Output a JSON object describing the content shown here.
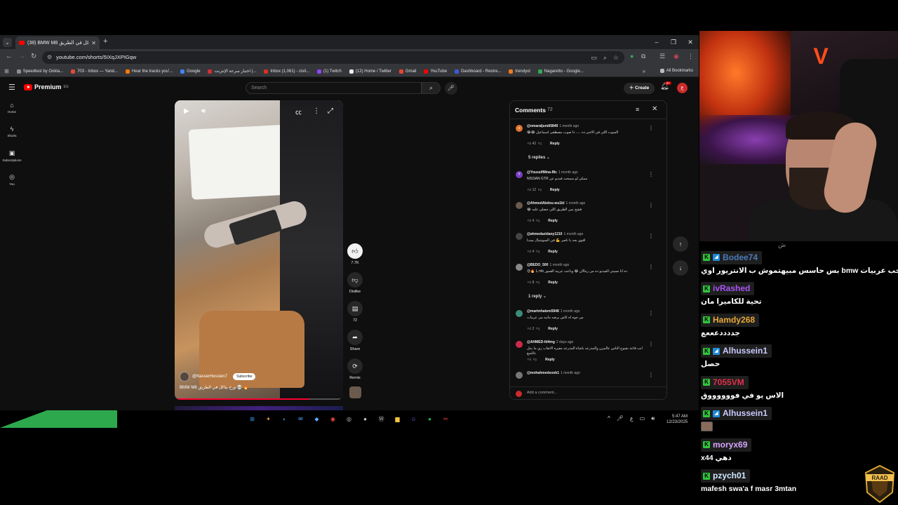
{
  "browser": {
    "tab_title": "(38) BMW M8 بياكل في الطريق",
    "new_tab": "+",
    "url": "youtube.com/shorts/5IXqJXPIGqw",
    "bookmarks": [
      {
        "label": "Speedtest by Ookla...",
        "color": "#8e8e8e"
      },
      {
        "label": "703 - Inbox — Yand...",
        "color": "#e04a3a"
      },
      {
        "label": "Hear the tracks you'...",
        "color": "#ff7a00"
      },
      {
        "label": "Google",
        "color": "#4285f4"
      },
      {
        "label": "اختبار سرعة الإنترنت |...",
        "color": "#d32f2f"
      },
      {
        "label": "Inbox (1,061) - civil...",
        "color": "#d93025"
      },
      {
        "label": "(1) Twitch",
        "color": "#9146ff"
      },
      {
        "label": "(12) Home / Twitter",
        "color": "#eeeeee"
      },
      {
        "label": "Gmail",
        "color": "#ea4335"
      },
      {
        "label": "YouTube",
        "color": "#ff0000"
      },
      {
        "label": "Dashboard - Restre...",
        "color": "#3b5bdb"
      },
      {
        "label": "trendyol",
        "color": "#f27a1a"
      },
      {
        "label": "Nagaretto - Google...",
        "color": "#34a853"
      }
    ],
    "all_bookmarks": "All Bookmarks"
  },
  "youtube": {
    "logo_text": "Premium",
    "logo_region": "EG",
    "search_placeholder": "Search",
    "create_label": "Create",
    "notif_count": "9+",
    "avatar_letter": "ع",
    "guide": [
      {
        "icon": "home-icon",
        "label": "Home"
      },
      {
        "icon": "shorts-icon",
        "label": "Shorts"
      },
      {
        "icon": "subscriptions-icon",
        "label": "Subscriptions"
      },
      {
        "icon": "you-icon",
        "label": "You"
      }
    ]
  },
  "short": {
    "channel": "@NasserHessien7",
    "subscribe": "Subscribe",
    "title": "BMW M8 ورخ بياكل في الطريق 💀 🔥",
    "progress": 0.8,
    "likes": "7.7K",
    "dislike_label": "Dislike",
    "comments_count": "72",
    "share_label": "Share",
    "remix_label": "Remix"
  },
  "comments_panel": {
    "title": "Comments",
    "count": "72",
    "add_comment": "Add a comment...",
    "items": [
      {
        "author": "@omaraljundi5849",
        "time": "1 month ago",
        "text": "السوت اللي في الاخير ده ..... دا صوت مصطفى اسماعيل 😂😂",
        "likes": "42",
        "reply": "Reply",
        "avatar": "o",
        "color": "#e0752c",
        "replies": "5 replies"
      },
      {
        "author": "@YoussifMina-f8c",
        "time": "1 month ago",
        "text": "ممكن لو سمحت فيديو عن NISSAN GTR",
        "likes": "12",
        "reply": "Reply",
        "avatar": "Y",
        "color": "#7a3fc2",
        "replies": ""
      },
      {
        "author": "@AhmedAbdou-wu1bl",
        "time": "1 month ago",
        "text": "فشخ يس الطريق اللي حصلي عليه 😂",
        "likes": "4",
        "reply": "Reply",
        "avatar": "",
        "color": "#6d5a4a",
        "replies": ""
      },
      {
        "author": "@ahmedazidany1210",
        "time": "1 month ago",
        "text": "اقوي بحد يا ناصر 💪 في السوشيال ميديا",
        "likes": "4",
        "reply": "Reply",
        "avatar": "",
        "color": "#444444",
        "replies": ""
      },
      {
        "author": "@BEDO_500",
        "time": "1 month ago",
        "text": "ده انا نسيتي الفيديو ده من زمااان 😂 وباعت عربية القمور mb يا 🔥😍",
        "likes": "8",
        "reply": "Reply",
        "avatar": "",
        "color": "#888888",
        "replies": "1 reply"
      },
      {
        "author": "@marimhatem5948",
        "time": "1 month ago",
        "text": "من جوه اه كاش برضه مانيه من عربيات",
        "likes": "2",
        "reply": "Reply",
        "avatar": "",
        "color": "#3a8d7a",
        "replies": ""
      },
      {
        "author": "@AHMED-fd4mg",
        "time": "2 days ago",
        "text": "انت قاعد تشوح الناس عالمزن والمدرعه باشاة المدرعه مقيره الانقاب زي ما ينتل عالميع",
        "likes": "",
        "reply": "Reply",
        "avatar": "",
        "color": "#cc2b4b",
        "replies": ""
      },
      {
        "author": "@mohahmedsook1",
        "time": "1 month ago",
        "text": "",
        "likes": "",
        "reply": "",
        "avatar": "",
        "color": "#777777",
        "replies": ""
      }
    ]
  },
  "taskbar": {
    "time": "5:47 AM",
    "date": "12/23/2025",
    "lang": "ع"
  },
  "chat": {
    "top_text": "ش",
    "messages": [
      {
        "user": "Bodee74",
        "color": "#4a7ab8",
        "prime": true,
        "text": "بس حاسس مبيهتموش ب الانتريور اوي bmw بحب عربيات",
        "emote": false
      },
      {
        "user": "ivRashed",
        "color": "#a855f7",
        "prime": false,
        "text": "تحية للكاميرا مان",
        "emote": false
      },
      {
        "user": "Hamdy268",
        "color": "#e8a838",
        "prime": false,
        "text": "جددددعععع",
        "emote": false
      },
      {
        "user": "Alhussein1",
        "color": "#c9c9ff",
        "prime": true,
        "text": "حصل",
        "emote": false
      },
      {
        "user": "7055VM",
        "color": "#e0304a",
        "prime": false,
        "text": "الاس يو في فووووووق",
        "emote": false
      },
      {
        "user": "Alhussein1",
        "color": "#c9c9ff",
        "prime": true,
        "text": "",
        "emote": true
      },
      {
        "user": "moryx69",
        "color": "#d5a6ff",
        "prime": false,
        "text": "x4دهي 4",
        "emote": false
      },
      {
        "user": "pzych01",
        "color": "#cfe8ff",
        "prime": false,
        "text": "mafesh swa'a f masr 3mtan",
        "emote": false
      }
    ]
  },
  "overlay": {
    "badge_text": "RAAD"
  },
  "colors": {
    "yt_red": "#ff0000",
    "kick_green": "#32c43c",
    "accent_orange": "#ff4d1c"
  }
}
